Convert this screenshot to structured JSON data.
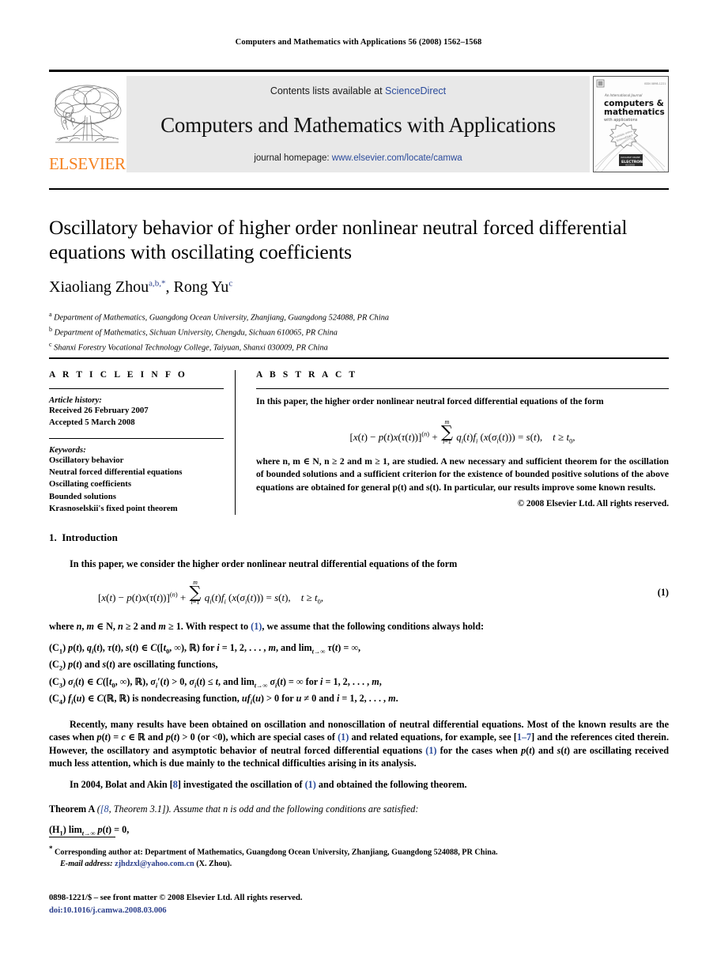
{
  "running_head": "Computers and Mathematics with Applications 56 (2008) 1562–1568",
  "masthead": {
    "publisher_wordmark": "ELSEVIER",
    "contents_prefix": "Contents lists available at ",
    "contents_link": "ScienceDirect",
    "journal_title": "Computers and Mathematics with Applications",
    "homepage_prefix": "journal homepage: ",
    "homepage_url": "www.elsevier.com/locate/camwa",
    "cover": {
      "line1": "An International Journal",
      "line2": "computers &",
      "line3": "mathematics",
      "line4": "with applications",
      "badge": "ELECTRONIC ACCESS",
      "issn_corner": "ISSN 0898-1221"
    }
  },
  "article": {
    "title": "Oscillatory behavior of higher order nonlinear neutral forced differential equations with oscillating coefficients",
    "authors_html": "Xiaoliang Zhou<sup>a,b,</sup><sup>*</sup>, Rong Yu<sup>c</sup>",
    "affiliations": [
      {
        "marker": "a",
        "text": "Department of Mathematics, Guangdong Ocean University, Zhanjiang, Guangdong 524088, PR China"
      },
      {
        "marker": "b",
        "text": "Department of Mathematics, Sichuan University, Chengdu, Sichuan 610065, PR China"
      },
      {
        "marker": "c",
        "text": "Shanxi Forestry Vocational Technology College, Taiyuan, Shanxi 030009, PR China"
      }
    ]
  },
  "article_info": {
    "label": "A R T I C L E    I N F O",
    "history_label": "Article history:",
    "history": [
      "Received 26 February 2007",
      "Accepted 5 March 2008"
    ],
    "keywords_label": "Keywords:",
    "keywords": [
      "Oscillatory behavior",
      "Neutral forced differential equations",
      "Oscillating coefficients",
      "Bounded solutions",
      "Krasnoselskii's fixed point theorem"
    ]
  },
  "abstract": {
    "label": "A B S T R A C T",
    "lead": "In this paper, the higher order nonlinear neutral forced differential equations of the form",
    "equation": "[x(t) − p(t)x(τ(t))]⁽ⁿ⁾ + Σ qᵢ(t)fᵢ (x(σᵢ(t))) = s(t),   t ≥ t₀,",
    "body": "where n, m ∈ N, n ≥ 2 and m ≥ 1, are studied. A new necessary and sufficient theorem for the oscillation of bounded solutions and a sufficient criterion for the existence of bounded positive solutions of the above equations are obtained for general p(t) and s(t). In particular, our results improve some known results.",
    "copyright": "© 2008 Elsevier Ltd. All rights reserved."
  },
  "body": {
    "section_number": "1.",
    "section_title": "Introduction",
    "intro_lead": "In this paper, we consider the higher order nonlinear neutral differential equations of the form",
    "equation_number": "(1)",
    "where_line": "where n, m ∈ N, n ≥ 2 and m ≥ 1. With respect to (1), we assume that the following conditions always hold:",
    "conditions": [
      {
        "tag": "(C₁)",
        "text": "p(t), qᵢ(t), τ(t), s(t) ∈ C([t₀, ∞), ℝ) for i = 1, 2, . . . , m, and limₜ→∞ τ(t) = ∞,"
      },
      {
        "tag": "(C₂)",
        "text": "p(t) and s(t) are oscillating functions,"
      },
      {
        "tag": "(C₃)",
        "text": "σᵢ(t) ∈ C([t₀, ∞), ℝ), σ′ᵢ(t) > 0, σᵢ(t) ≤ t, and limₜ→∞ σᵢ(t) = ∞ for i = 1, 2, . . . , m,"
      },
      {
        "tag": "(C₄)",
        "text": "fᵢ(u) ∈ C(ℝ, ℝ) is nondecreasing function, ufᵢ(u) > 0 for u ≠ 0 and i = 1, 2, . . . , m."
      }
    ],
    "para_recently": "Recently, many results have been obtained on oscillation and nonoscillation of neutral differential equations. Most of the known results are the cases when p(t) = c ∈ ℝ and p(t) > 0 (or <0), which are special cases of (1) and related equations, for example, see [1–7] and the references cited therein. However, the oscillatory and asymptotic behavior of neutral forced differential equations (1) for the cases when p(t) and s(t) are oscillating received much less attention, which is due mainly to the technical difficulties arising in its analysis.",
    "para_bolat": "In 2004, Bolat and Akin [8] investigated the oscillation of (1) and obtained the following theorem.",
    "theorem_label": "Theorem A",
    "theorem_cite": "([8, Theorem 3.1]).",
    "theorem_text": "Assume that n is odd and the following conditions are satisfied:",
    "h1_tag": "(H₁)",
    "h1_text": "limₜ→∞ p(t) = 0,"
  },
  "footnote": {
    "star": "*",
    "corresponding": "Corresponding author at: Department of Mathematics, Guangdong Ocean University, Zhanjiang, Guangdong 524088, PR China.",
    "email_label": "E-mail address:",
    "email": "zjhdzxl@yahoo.com.cn",
    "email_suffix": "(X. Zhou)."
  },
  "colophon": {
    "issn_line": "0898-1221/$ – see front matter © 2008 Elsevier Ltd. All rights reserved.",
    "doi": "doi:10.1016/j.camwa.2008.03.006"
  },
  "colors": {
    "link_blue": "#2b4b9b",
    "elsevier_orange": "#F58220",
    "banner_gray": "#e8e8e8"
  }
}
